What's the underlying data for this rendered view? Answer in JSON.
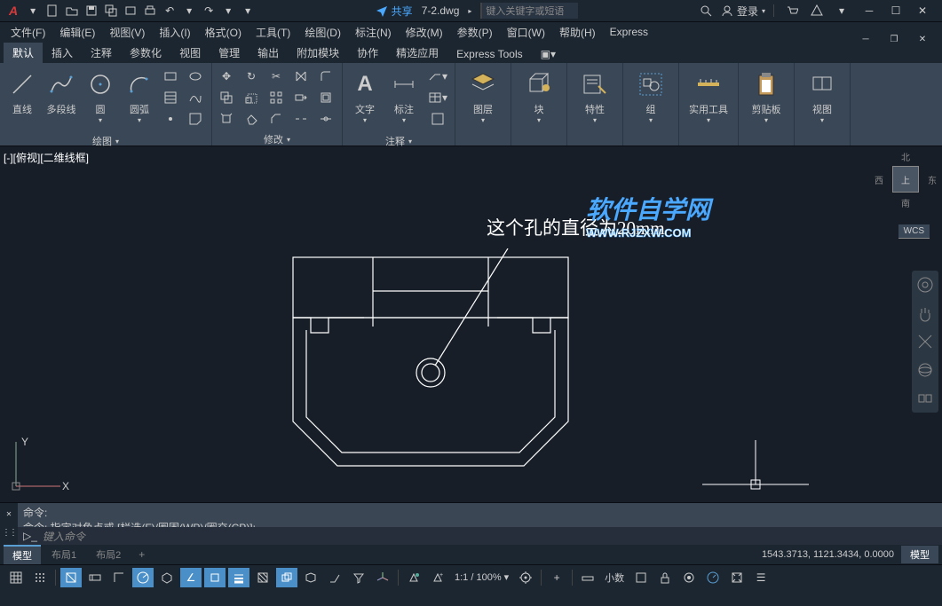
{
  "titlebar": {
    "share": "共享",
    "filename": "7-2.dwg",
    "search_placeholder": "键入关键字或短语",
    "login": "登录"
  },
  "menubar": [
    "文件(F)",
    "编辑(E)",
    "视图(V)",
    "插入(I)",
    "格式(O)",
    "工具(T)",
    "绘图(D)",
    "标注(N)",
    "修改(M)",
    "参数(P)",
    "窗口(W)",
    "帮助(H)",
    "Express"
  ],
  "ribbon_tabs": [
    "默认",
    "插入",
    "注释",
    "参数化",
    "视图",
    "管理",
    "输出",
    "附加模块",
    "协作",
    "精选应用",
    "Express Tools"
  ],
  "ribbon": {
    "draw": {
      "line": "直线",
      "polyline": "多段线",
      "circle": "圆",
      "arc": "圆弧",
      "title": "绘图"
    },
    "modify": {
      "title": "修改"
    },
    "annotate": {
      "text": "文字",
      "dim": "标注",
      "title": "注释"
    },
    "layer": {
      "label": "图层"
    },
    "block": {
      "label": "块"
    },
    "props": {
      "label": "特性"
    },
    "group": {
      "label": "组"
    },
    "util": {
      "label": "实用工具"
    },
    "clip": {
      "label": "剪贴板"
    },
    "view": {
      "label": "视图"
    }
  },
  "canvas": {
    "viewport_label": "[-][俯视][二维线框]",
    "annotation": "这个孔的直径为20mm",
    "viewcube": {
      "top": "上",
      "n": "北",
      "s": "南",
      "e": "东",
      "w": "西",
      "wcs": "WCS"
    },
    "ucs": {
      "x": "X",
      "y": "Y"
    }
  },
  "watermark": {
    "row1": "软件自学网",
    "row2": "WWW.RJZXW.COM"
  },
  "cmdline": {
    "hist1": "命令:",
    "hist2": "命令: 指定对角点或 [栏选(F)/圈围(WP)/圈交(CP)]:",
    "placeholder": "键入命令"
  },
  "tabs": {
    "model": "模型",
    "layout1": "布局1",
    "layout2": "布局2",
    "model_space": "模型"
  },
  "coords": "1543.3713, 1121.3434, 0.0000",
  "status": {
    "scale": "1:1 / 100%",
    "decimal": "小数"
  }
}
